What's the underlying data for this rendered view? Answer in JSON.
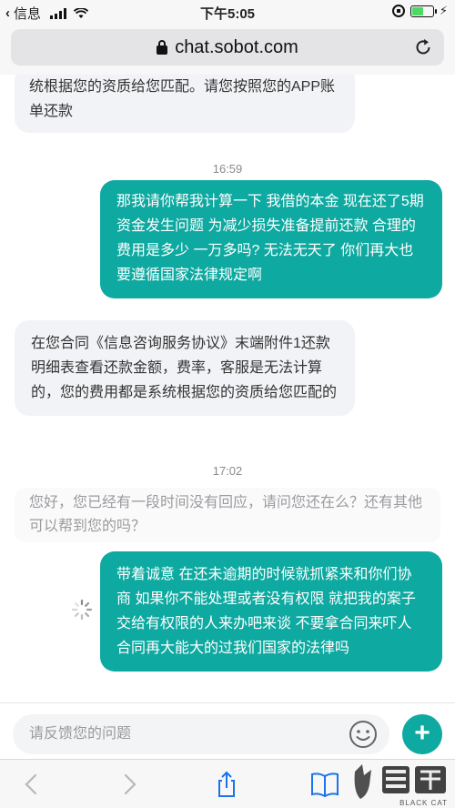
{
  "status_bar": {
    "carrier": "信息",
    "time": "下午5:05"
  },
  "browser": {
    "url": "chat.sobot.com"
  },
  "messages": [
    {
      "from": "agent",
      "text": "统根据您的资质给您匹配。请您按照您的APP账单还款"
    },
    {
      "type": "timestamp",
      "text": "16:59"
    },
    {
      "from": "user",
      "text": "那我请你帮我计算一下 我借的本金 现在还了5期 资金发生问题 为减少损失准备提前还款 合理的费用是多少 一万多吗? 无法无天了 你们再大也要遵循国家法律规定啊"
    },
    {
      "from": "agent",
      "text": "在您合同《信息咨询服务协议》末端附件1还款明细表查看还款金额，费率，客服是无法计算的，您的费用都是系统根据您的资质给您匹配的"
    },
    {
      "type": "timestamp",
      "text": "17:02"
    },
    {
      "type": "notice",
      "text": "您好，您已经有一段时间没有回应，请问您还在么？还有其他可以帮到您的吗？"
    },
    {
      "from": "user",
      "text": "带着诚意 在还未逾期的时候就抓紧来和你们协商 如果你不能处理或者没有权限 就把我的案子交给有权限的人来办吧来谈 不要拿合同来吓人 合同再大能大的过我们国家的法律吗"
    }
  ],
  "input": {
    "placeholder": "请反馈您的问题"
  },
  "watermark": {
    "text": "BLACK CAT"
  },
  "colors": {
    "accent": "#0ea9a0",
    "agent_bubble": "#f2f3f6"
  }
}
